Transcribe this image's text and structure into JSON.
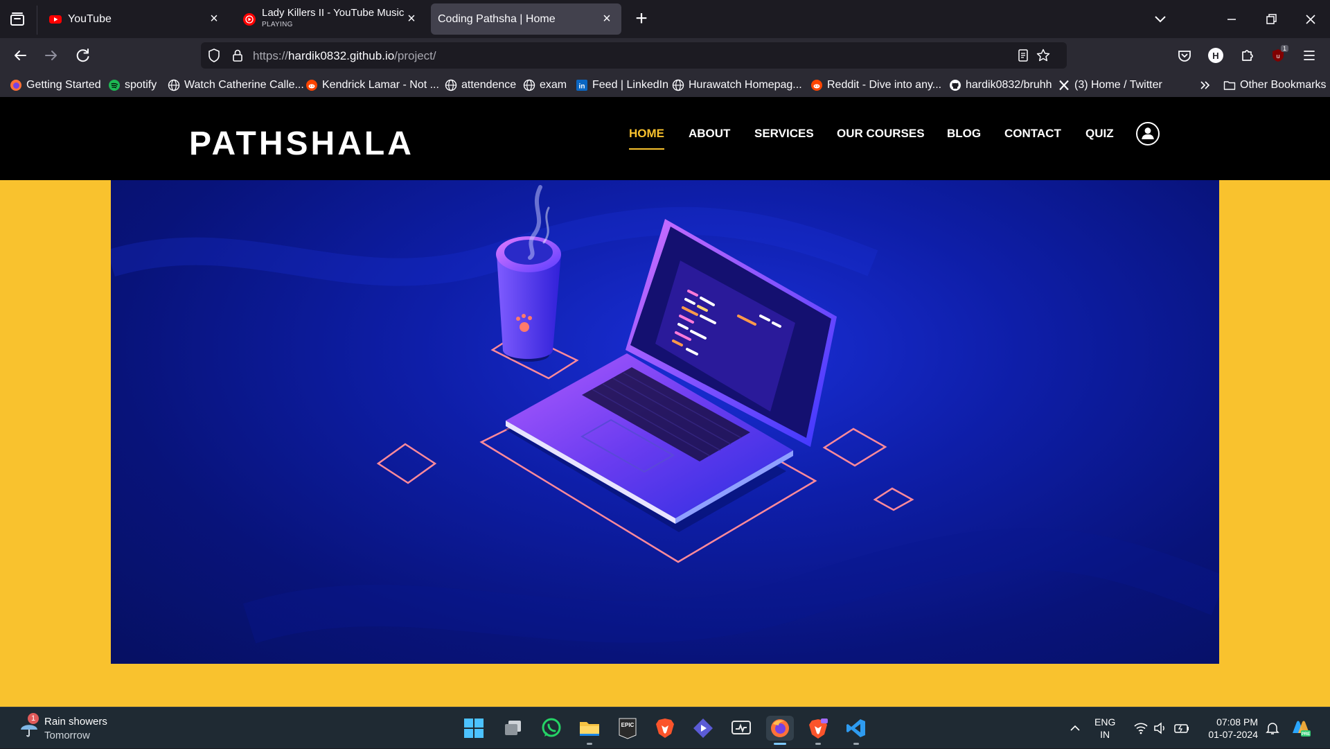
{
  "browser": {
    "tabs": [
      {
        "title": "YouTube",
        "subtitle": "",
        "active": false
      },
      {
        "title": "Lady Killers II - YouTube Music",
        "subtitle": "PLAYING",
        "active": false
      },
      {
        "title": "Coding Pathsha | Home",
        "subtitle": "",
        "active": true
      }
    ],
    "url": {
      "prefix": "https://",
      "host": "hardik0832.github.io",
      "path": "/project/"
    },
    "bookmarks": [
      {
        "label": "Getting Started",
        "icon": "firefox-icon"
      },
      {
        "label": "spotify",
        "icon": "spotify-icon"
      },
      {
        "label": "Watch Catherine Calle...",
        "icon": "globe-icon"
      },
      {
        "label": "Kendrick Lamar - Not ...",
        "icon": "reddit-icon"
      },
      {
        "label": "attendence",
        "icon": "globe-icon"
      },
      {
        "label": "exam",
        "icon": "globe-icon"
      },
      {
        "label": "Feed | LinkedIn",
        "icon": "linkedin-icon"
      },
      {
        "label": "Hurawatch Homepag...",
        "icon": "globe-icon"
      },
      {
        "label": "Reddit - Dive into any...",
        "icon": "reddit-icon"
      },
      {
        "label": "hardik0832/bruhh",
        "icon": "github-icon"
      },
      {
        "label": "(3) Home / Twitter",
        "icon": "x-icon"
      }
    ],
    "other_bookmarks": "Other Bookmarks",
    "extension_badge": "1",
    "profile_letter": "H"
  },
  "site": {
    "logo": "PATHSHALA",
    "nav": [
      "HOME",
      "ABOUT",
      "SERVICES",
      "OUR COURSES",
      "BLOG",
      "CONTACT",
      "QUIZ"
    ],
    "active_nav": "HOME",
    "colors": {
      "accent": "#f9c22e",
      "header": "#000000",
      "hero": "#0b1a9a"
    }
  },
  "taskbar": {
    "weather": {
      "line1": "Rain showers",
      "line2": "Tomorrow",
      "badge": "1"
    },
    "language": {
      "line1": "ENG",
      "line2": "IN"
    },
    "time": "07:08 PM",
    "date": "01-07-2024"
  }
}
